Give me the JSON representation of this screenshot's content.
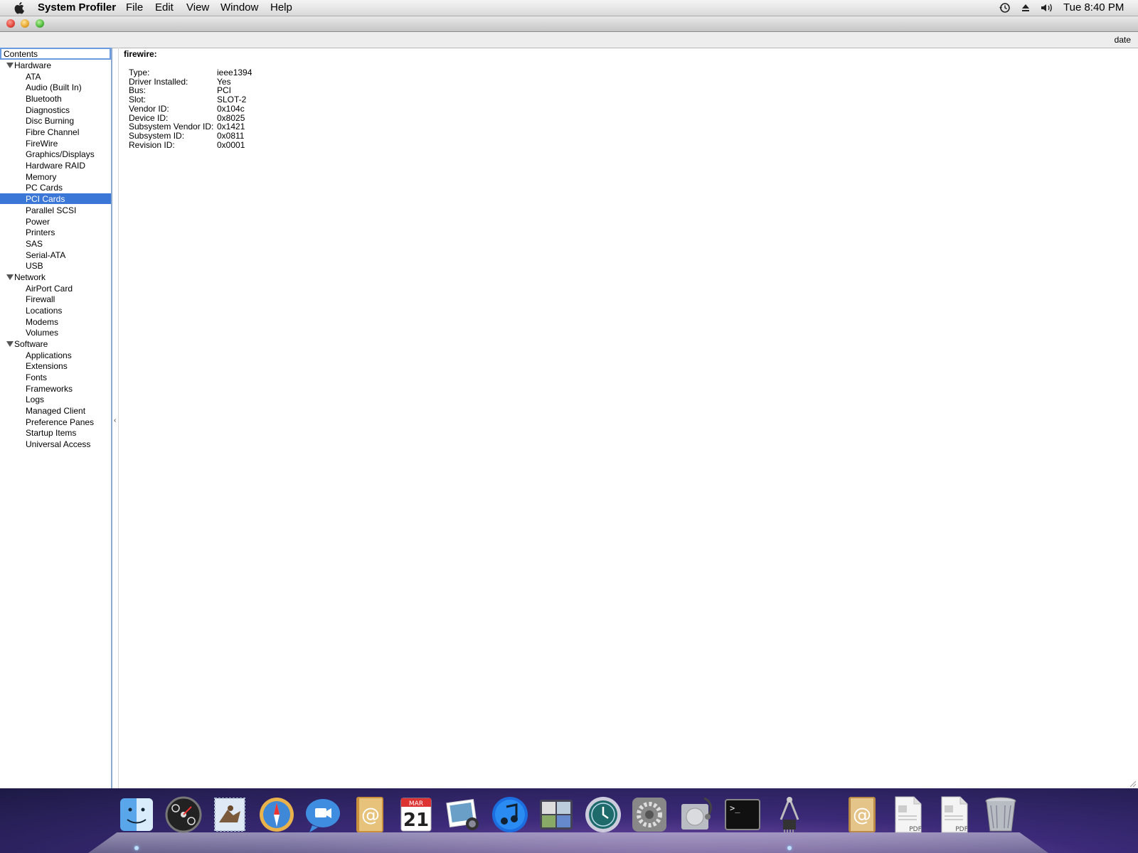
{
  "menubar": {
    "app_name": "System Profiler",
    "items": [
      "File",
      "Edit",
      "View",
      "Window",
      "Help"
    ],
    "clock": "Tue 8:40 PM"
  },
  "window": {
    "header_right": "date"
  },
  "sidebar": {
    "header": "Contents",
    "selected": "PCI Cards",
    "groups": [
      {
        "label": "Hardware",
        "items": [
          "ATA",
          "Audio (Built In)",
          "Bluetooth",
          "Diagnostics",
          "Disc Burning",
          "Fibre Channel",
          "FireWire",
          "Graphics/Displays",
          "Hardware RAID",
          "Memory",
          "PC Cards",
          "PCI Cards",
          "Parallel SCSI",
          "Power",
          "Printers",
          "SAS",
          "Serial-ATA",
          "USB"
        ]
      },
      {
        "label": "Network",
        "items": [
          "AirPort Card",
          "Firewall",
          "Locations",
          "Modems",
          "Volumes"
        ]
      },
      {
        "label": "Software",
        "items": [
          "Applications",
          "Extensions",
          "Fonts",
          "Frameworks",
          "Logs",
          "Managed Client",
          "Preference Panes",
          "Startup Items",
          "Universal Access"
        ]
      }
    ]
  },
  "content": {
    "title": "firewire:",
    "properties": [
      {
        "key": "Type:",
        "value": "ieee1394"
      },
      {
        "key": "Driver Installed:",
        "value": "Yes"
      },
      {
        "key": "Bus:",
        "value": "PCI"
      },
      {
        "key": "Slot:",
        "value": "SLOT-2"
      },
      {
        "key": "Vendor ID:",
        "value": "0x104c"
      },
      {
        "key": "Device ID:",
        "value": "0x8025"
      },
      {
        "key": "Subsystem Vendor ID:",
        "value": "0x1421"
      },
      {
        "key": "Subsystem ID:",
        "value": "0x0811"
      },
      {
        "key": "Revision ID:",
        "value": "0x0001"
      }
    ]
  },
  "dock": {
    "items": [
      {
        "icon": "finder-icon",
        "running": true
      },
      {
        "icon": "dashboard-icon",
        "running": false
      },
      {
        "icon": "mail-stamp-icon",
        "running": false
      },
      {
        "icon": "safari-icon",
        "running": false
      },
      {
        "icon": "ichat-icon",
        "running": false
      },
      {
        "icon": "address-book-icon",
        "running": false
      },
      {
        "icon": "ical-icon",
        "running": false,
        "month": "MAR",
        "day": "21"
      },
      {
        "icon": "iphoto-icon",
        "running": false
      },
      {
        "icon": "itunes-icon",
        "running": false
      },
      {
        "icon": "spaces-icon",
        "running": false
      },
      {
        "icon": "time-machine-icon",
        "running": false
      },
      {
        "icon": "system-preferences-icon",
        "running": false
      },
      {
        "icon": "disk-utility-icon",
        "running": false
      },
      {
        "icon": "terminal-icon",
        "running": false
      },
      {
        "icon": "system-profiler-icon",
        "running": true
      },
      {
        "icon": "downloads-stack-icon",
        "running": false
      },
      {
        "icon": "pdf-document-icon",
        "running": false,
        "label": "PDF"
      },
      {
        "icon": "pdf-document-icon",
        "running": false,
        "label": "PDF"
      },
      {
        "icon": "trash-icon",
        "running": false
      }
    ]
  }
}
